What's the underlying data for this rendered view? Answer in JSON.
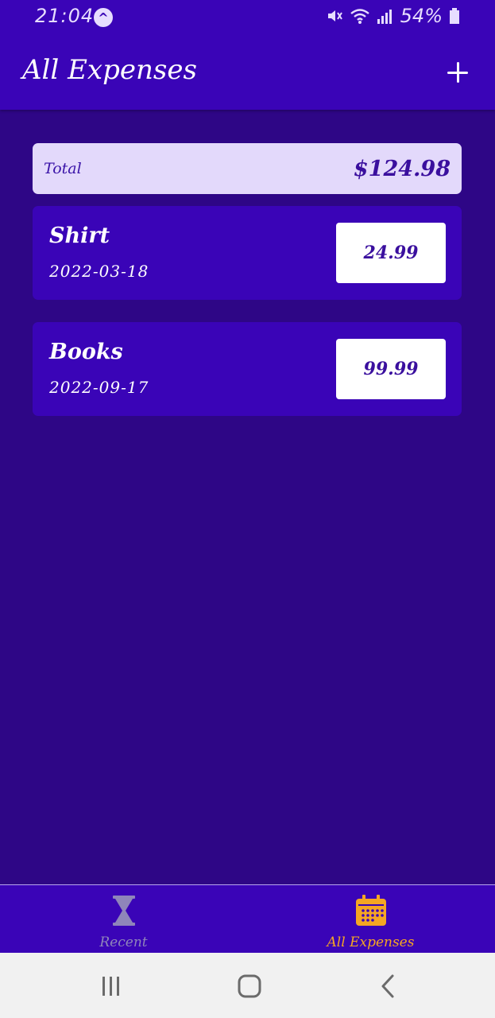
{
  "status_bar": {
    "time": "21:04",
    "battery": "54%"
  },
  "header": {
    "title": "All Expenses",
    "add_icon": "plus-icon"
  },
  "summary": {
    "label": "Total",
    "total": "$124.98"
  },
  "expenses": [
    {
      "title": "Shirt",
      "date": "2022-03-18",
      "amount": "24.99"
    },
    {
      "title": "Books",
      "date": "2022-09-17",
      "amount": "99.99"
    }
  ],
  "tabs": [
    {
      "label": "Recent",
      "icon": "hourglass-icon",
      "active": false
    },
    {
      "label": "All Expenses",
      "icon": "calendar-icon",
      "active": true
    }
  ],
  "colors": {
    "primary": "#3a04b7",
    "background": "#2e0686",
    "accent": "#f5a623",
    "summary_bg": "#e3d9fb"
  }
}
